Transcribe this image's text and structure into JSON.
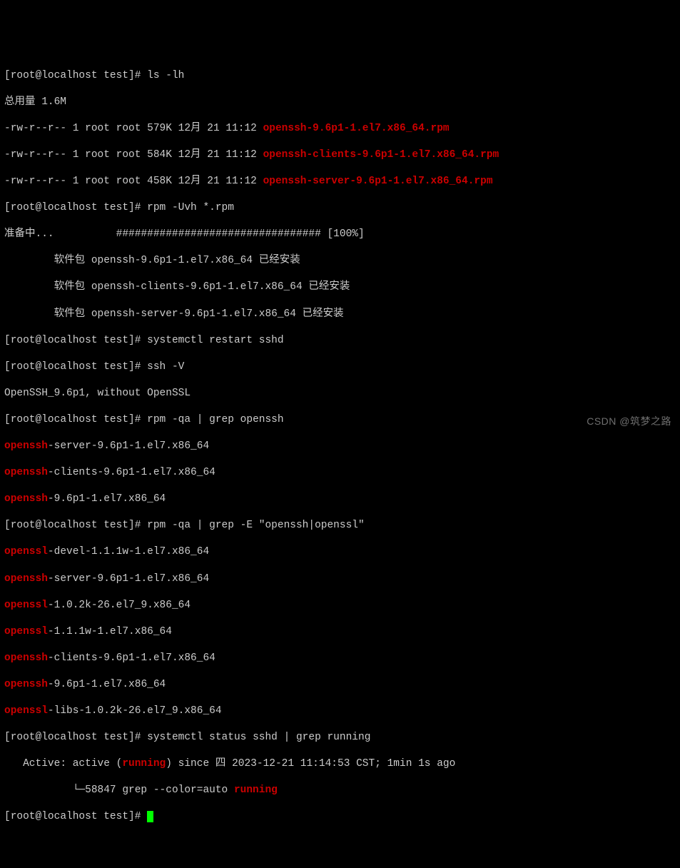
{
  "prompt": "[root@localhost test]# ",
  "cmds": {
    "ls": "ls -lh",
    "rpm_install": "rpm -Uvh *.rpm",
    "restart": "systemctl restart sshd",
    "ssh_v": "ssh -V",
    "rpm_qa1": "rpm -qa | grep openssh",
    "rpm_qa2": "rpm -qa | grep -E \"openssh|openssl\"",
    "status": "systemctl status sshd | grep running"
  },
  "ls_header": "总用量 1.6M",
  "ls_rows": [
    {
      "perm": "-rw-r--r-- 1 root root 579K 12月 21 11:12 ",
      "file": "openssh-9.6p1-1.el7.x86_64.rpm"
    },
    {
      "perm": "-rw-r--r-- 1 root root 584K 12月 21 11:12 ",
      "file": "openssh-clients-9.6p1-1.el7.x86_64.rpm"
    },
    {
      "perm": "-rw-r--r-- 1 root root 458K 12月 21 11:12 ",
      "file": "openssh-server-9.6p1-1.el7.x86_64.rpm"
    }
  ],
  "prepare": {
    "label": "准备中...",
    "bar": "          ################################# [100%]"
  },
  "installed_prefix": "        软件包 ",
  "installed_suffix": " 已经安装",
  "installed": [
    "openssh-9.6p1-1.el7.x86_64",
    "openssh-clients-9.6p1-1.el7.x86_64",
    "openssh-server-9.6p1-1.el7.x86_64"
  ],
  "ssh_version": "OpenSSH_9.6p1, without OpenSSL",
  "grep1": [
    {
      "hi": "openssh",
      "rest": "-server-9.6p1-1.el7.x86_64"
    },
    {
      "hi": "openssh",
      "rest": "-clients-9.6p1-1.el7.x86_64"
    },
    {
      "hi": "openssh",
      "rest": "-9.6p1-1.el7.x86_64"
    }
  ],
  "grep2": [
    {
      "hi": "openssl",
      "rest": "-devel-1.1.1w-1.el7.x86_64"
    },
    {
      "hi": "openssh",
      "rest": "-server-9.6p1-1.el7.x86_64"
    },
    {
      "hi": "openssl",
      "rest": "-1.0.2k-26.el7_9.x86_64"
    },
    {
      "hi": "openssl",
      "rest": "-1.1.1w-1.el7.x86_64"
    },
    {
      "hi": "openssh",
      "rest": "-clients-9.6p1-1.el7.x86_64"
    },
    {
      "hi": "openssh",
      "rest": "-9.6p1-1.el7.x86_64"
    },
    {
      "hi": "openssl",
      "rest": "-libs-1.0.2k-26.el7_9.x86_64"
    }
  ],
  "status_out": {
    "active_a": "   Active: active (",
    "running": "running",
    "active_b": ") since 四 2023-12-21 11:14:53 CST; 1min 1s ago",
    "grep_line_a": "           └─58847 grep --color=auto ",
    "grep_line_b": "running"
  },
  "watermark": "CSDN @筑梦之路"
}
